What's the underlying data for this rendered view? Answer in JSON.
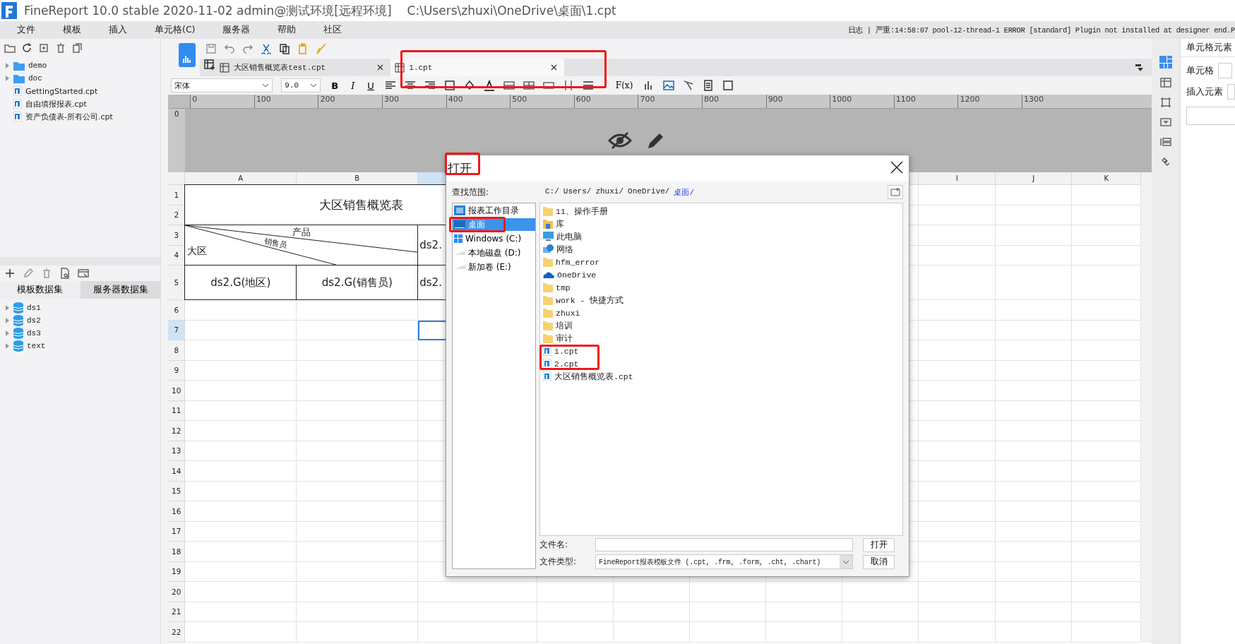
{
  "window": {
    "title": "FineReport 10.0 stable 2020-11-02 admin@测试环境[远程环境]",
    "path": "C:\\Users\\zhuxi\\OneDrive\\桌面\\1.cpt"
  },
  "menu": [
    "文件",
    "模板",
    "插入",
    "单元格(C)",
    "服务器",
    "帮助",
    "社区"
  ],
  "log": "日志 | 严重:14:58:07 pool-12-thread-1 ERROR [standard] Plugin not installed at designer end.P",
  "file_tree": [
    {
      "label": "demo",
      "kind": "folder",
      "expanded": false
    },
    {
      "label": "doc",
      "kind": "folder",
      "expanded": false
    },
    {
      "label": "GettingStarted.cpt",
      "kind": "file"
    },
    {
      "label": "自由填报报表.cpt",
      "kind": "file"
    },
    {
      "label": "资产负债表-所有公司.cpt",
      "kind": "file"
    }
  ],
  "dataset_tabs": [
    {
      "label": "模板数据集",
      "selected": true
    },
    {
      "label": "服务器数据集",
      "selected": false
    }
  ],
  "datasets": [
    {
      "label": "ds1",
      "expanded": false
    },
    {
      "label": "ds2",
      "expanded": false
    },
    {
      "label": "ds3",
      "expanded": false
    },
    {
      "label": "text",
      "expanded": false
    }
  ],
  "editor_tabs": [
    {
      "label": "大区销售概览表test.cpt",
      "selected": false
    },
    {
      "label": "1.cpt",
      "selected": true
    }
  ],
  "format_bar": {
    "font": "宋体",
    "size": "9.0",
    "styles": [
      "B",
      "I",
      "U"
    ],
    "formula": "F(x)"
  },
  "ruler": [
    "0",
    "100",
    "200",
    "300",
    "400",
    "500",
    "600",
    "700",
    "800",
    "900",
    "1000",
    "1100",
    "1200",
    "1300"
  ],
  "ruler_v": "0",
  "grid": {
    "columns": [
      {
        "label": "A",
        "selected": false
      },
      {
        "label": "B",
        "selected": false
      },
      {
        "selected": true
      },
      {
        "label": "I",
        "selected": false
      },
      {
        "label": "J",
        "selected": false
      },
      {
        "label": "K",
        "selected": false
      }
    ],
    "rows": [
      {
        "label": "1",
        "selected": false
      },
      {
        "label": "2",
        "selected": false
      },
      {
        "label": "3",
        "selected": false
      },
      {
        "label": "4",
        "selected": false
      },
      {
        "label": "5",
        "selected": false
      },
      {
        "label": "6",
        "selected": false
      },
      {
        "label": "7",
        "selected": true
      },
      {
        "label": "8",
        "selected": false
      },
      {
        "label": "9",
        "selected": false
      },
      {
        "label": "10",
        "selected": false
      },
      {
        "label": "11",
        "selected": false
      },
      {
        "label": "12",
        "selected": false
      },
      {
        "label": "13",
        "selected": false
      },
      {
        "label": "14",
        "selected": false
      },
      {
        "label": "15",
        "selected": false
      },
      {
        "label": "16",
        "selected": false
      },
      {
        "label": "17",
        "selected": false
      },
      {
        "label": "18",
        "selected": false
      },
      {
        "label": "19",
        "selected": false
      },
      {
        "label": "20",
        "selected": false
      },
      {
        "label": "21",
        "selected": false
      },
      {
        "label": "22",
        "selected": false
      }
    ],
    "cells": [
      {
        "kind": "title",
        "text": "大区销售概览表"
      },
      {
        "kind": "diagonal",
        "labels": [
          "产品",
          "销售员",
          "大区"
        ]
      },
      {
        "kind": "text",
        "text": "ds2."
      },
      {
        "kind": "center",
        "text": "ds2.G(地区)"
      },
      {
        "kind": "center",
        "text": "ds2.G(销售员)"
      },
      {
        "kind": "text",
        "text": "ds2."
      }
    ]
  },
  "dialog": {
    "title": "打开",
    "look_in_label": "查找范围:",
    "path": [
      {
        "label": "C:/",
        "selected": false
      },
      {
        "label": "Users/",
        "selected": false
      },
      {
        "label": "zhuxi/",
        "selected": false
      },
      {
        "label": "OneDrive/",
        "selected": false
      },
      {
        "label": "桌面/",
        "selected": true
      }
    ],
    "places": [
      {
        "label": "报表工作目录",
        "kind": "workdir",
        "selected": false
      },
      {
        "label": "桌面",
        "kind": "desktop",
        "selected": true
      },
      {
        "label": "Windows (C:)",
        "kind": "windows",
        "selected": false
      },
      {
        "label": "本地磁盘 (D:)",
        "kind": "drive",
        "selected": false
      },
      {
        "label": "新加卷 (E:)",
        "kind": "drive",
        "selected": false
      }
    ],
    "files": [
      {
        "label": "11、操作手册",
        "kind": "folder"
      },
      {
        "label": "库",
        "kind": "library"
      },
      {
        "label": "此电脑",
        "kind": "computer"
      },
      {
        "label": "网络",
        "kind": "network"
      },
      {
        "label": "hfm_error",
        "kind": "folder"
      },
      {
        "label": "OneDrive",
        "kind": "cloud"
      },
      {
        "label": "tmp",
        "kind": "folder"
      },
      {
        "label": "work - 快捷方式",
        "kind": "folder"
      },
      {
        "label": "zhuxi",
        "kind": "folder"
      },
      {
        "label": "培训",
        "kind": "folder"
      },
      {
        "label": "审计",
        "kind": "folder"
      },
      {
        "label": "1.cpt",
        "kind": "report"
      },
      {
        "label": "2.cpt",
        "kind": "report"
      },
      {
        "label": "大区销售概览表.cpt",
        "kind": "report"
      }
    ],
    "file_name_label": "文件名:",
    "file_type_label": "文件类型:",
    "file_type": "FineReport报表模板文件 (.cpt, .frm, .form, .cht, .chart)",
    "buttons": [
      "打开",
      "取消"
    ]
  },
  "right_panel": {
    "title": "单元格元素",
    "fields": [
      "单元格",
      "插入元素"
    ]
  }
}
